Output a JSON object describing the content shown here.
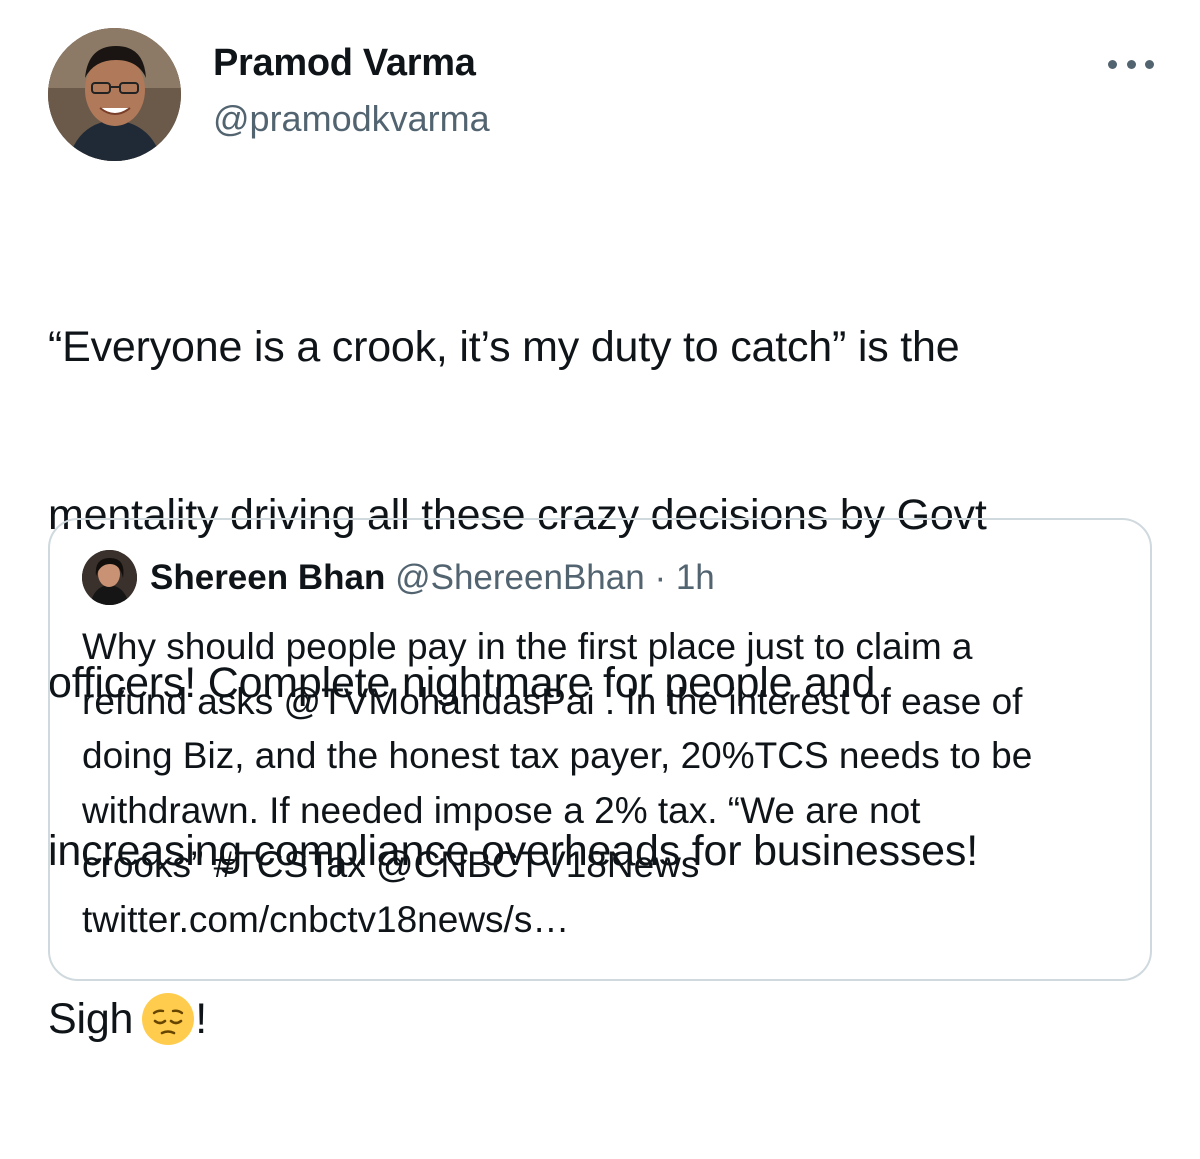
{
  "author": {
    "name": "Pramod Varma",
    "handle": "@pramodkvarma"
  },
  "tweet": {
    "lines": [
      "“Everyone is a crook, it’s my duty to catch” is the",
      "mentality driving all these crazy decisions by Govt",
      "officers! Complete nightmare for people and",
      "increasing compliance overheads for businesses!"
    ],
    "last_line_start": "Sigh",
    "emoji": "pensive-face-emoji",
    "last_line_end": "!"
  },
  "quote": {
    "name": "Shereen Bhan",
    "handle": "@ShereenBhan",
    "separator": "·",
    "time": "1h",
    "lines": [
      "Why should people pay in the first place just to claim a",
      "refund asks @TVMohandasPai . In the interest of ease of",
      "doing Biz, and the honest tax payer, 20%TCS needs to be",
      "withdrawn. If needed impose a 2% tax. “We are not",
      "crooks” #TCSTax @CNBCTV18News",
      "twitter.com/cnbctv18news/s…"
    ]
  },
  "icons": {
    "more": "more-dots-icon"
  },
  "colors": {
    "text": "#0f1419",
    "secondary": "#536471",
    "border": "#cfd9de",
    "emoji": "#ffcc4d"
  }
}
